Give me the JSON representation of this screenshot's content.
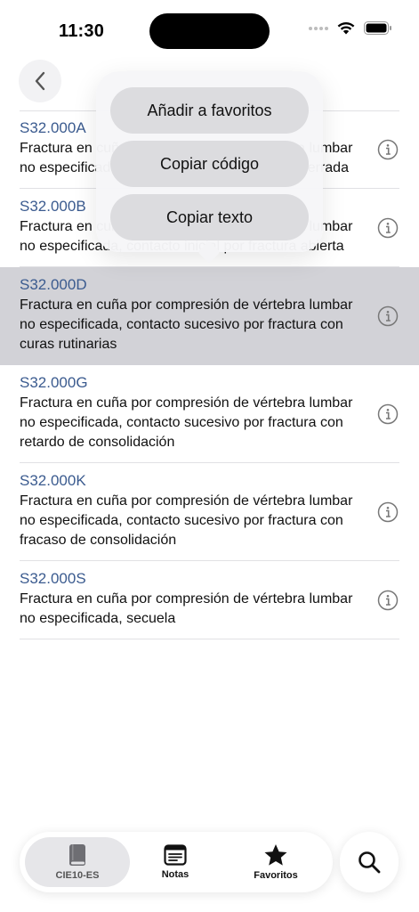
{
  "status_bar": {
    "time": "11:30"
  },
  "menu": {
    "items": [
      {
        "label": "Añadir a favoritos"
      },
      {
        "label": "Copiar código"
      },
      {
        "label": "Copiar texto"
      }
    ]
  },
  "list": {
    "rows": [
      {
        "code": "S32.000A",
        "description": "Fractura en cuña por compresión de vértebra lumbar no especificada, contacto inicial por fractura cerrada"
      },
      {
        "code": "S32.000B",
        "description": "Fractura en cuña por compresión de vértebra lumbar no especificada, contacto inicial por fractura abierta"
      },
      {
        "code": "S32.000D",
        "description": "Fractura en cuña por compresión de vértebra lumbar no especificada, contacto sucesivo por fractura con curas rutinarias"
      },
      {
        "code": "S32.000G",
        "description": "Fractura en cuña por compresión de vértebra lumbar no especificada, contacto sucesivo por fractura con retardo de consolidación"
      },
      {
        "code": "S32.000K",
        "description": "Fractura en cuña por compresión de vértebra lumbar no especificada, contacto sucesivo por fractura con fracaso de consolidación"
      },
      {
        "code": "S32.000S",
        "description": "Fractura en cuña por compresión de vértebra lumbar no especificada, secuela"
      }
    ]
  },
  "tabbar": {
    "tabs": [
      {
        "label": "CIE10-ES",
        "icon": "book-icon"
      },
      {
        "label": "Notas",
        "icon": "notes-icon"
      },
      {
        "label": "Favoritos",
        "icon": "star-icon"
      }
    ]
  },
  "colors": {
    "code_blue": "#3b5b8f",
    "selected_row": "#d2d2d7"
  }
}
